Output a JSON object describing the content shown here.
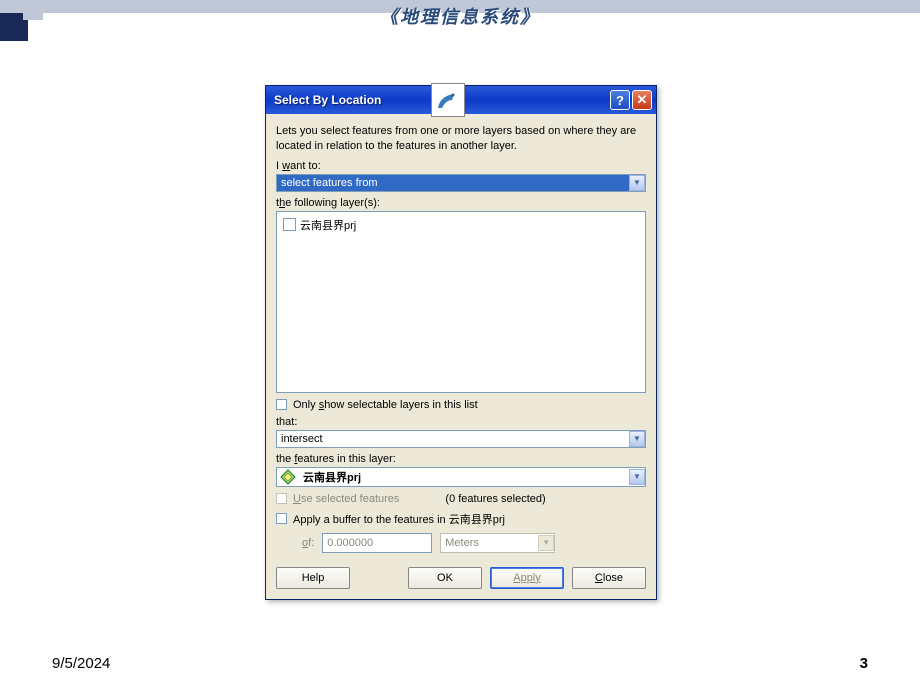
{
  "slide": {
    "title": "《地理信息系统》",
    "date": "9/5/2024",
    "page": "3"
  },
  "dialog": {
    "title": "Select By Location",
    "intro": "Lets you select features from one or more layers based on where they are located in relation to the features in another layer.",
    "iwant_label": "I want to:",
    "iwant_value": "select features from",
    "following_label": "the following layer(s):",
    "layer_item": "云南县界prj",
    "only_selectable": "Only show selectable layers in this list",
    "that_label": "that:",
    "that_value": "intersect",
    "features_label": "the features in this layer:",
    "features_value": "云南县界prj",
    "use_selected": "Use selected features",
    "selected_count": "(0 features selected)",
    "apply_buffer": "Apply a buffer to the features in 云南县界prj",
    "of_label": "of:",
    "buffer_value": "0.000000",
    "buffer_unit": "Meters",
    "buttons": {
      "help": "Help",
      "ok": "OK",
      "apply": "Apply",
      "close": "Close"
    }
  }
}
